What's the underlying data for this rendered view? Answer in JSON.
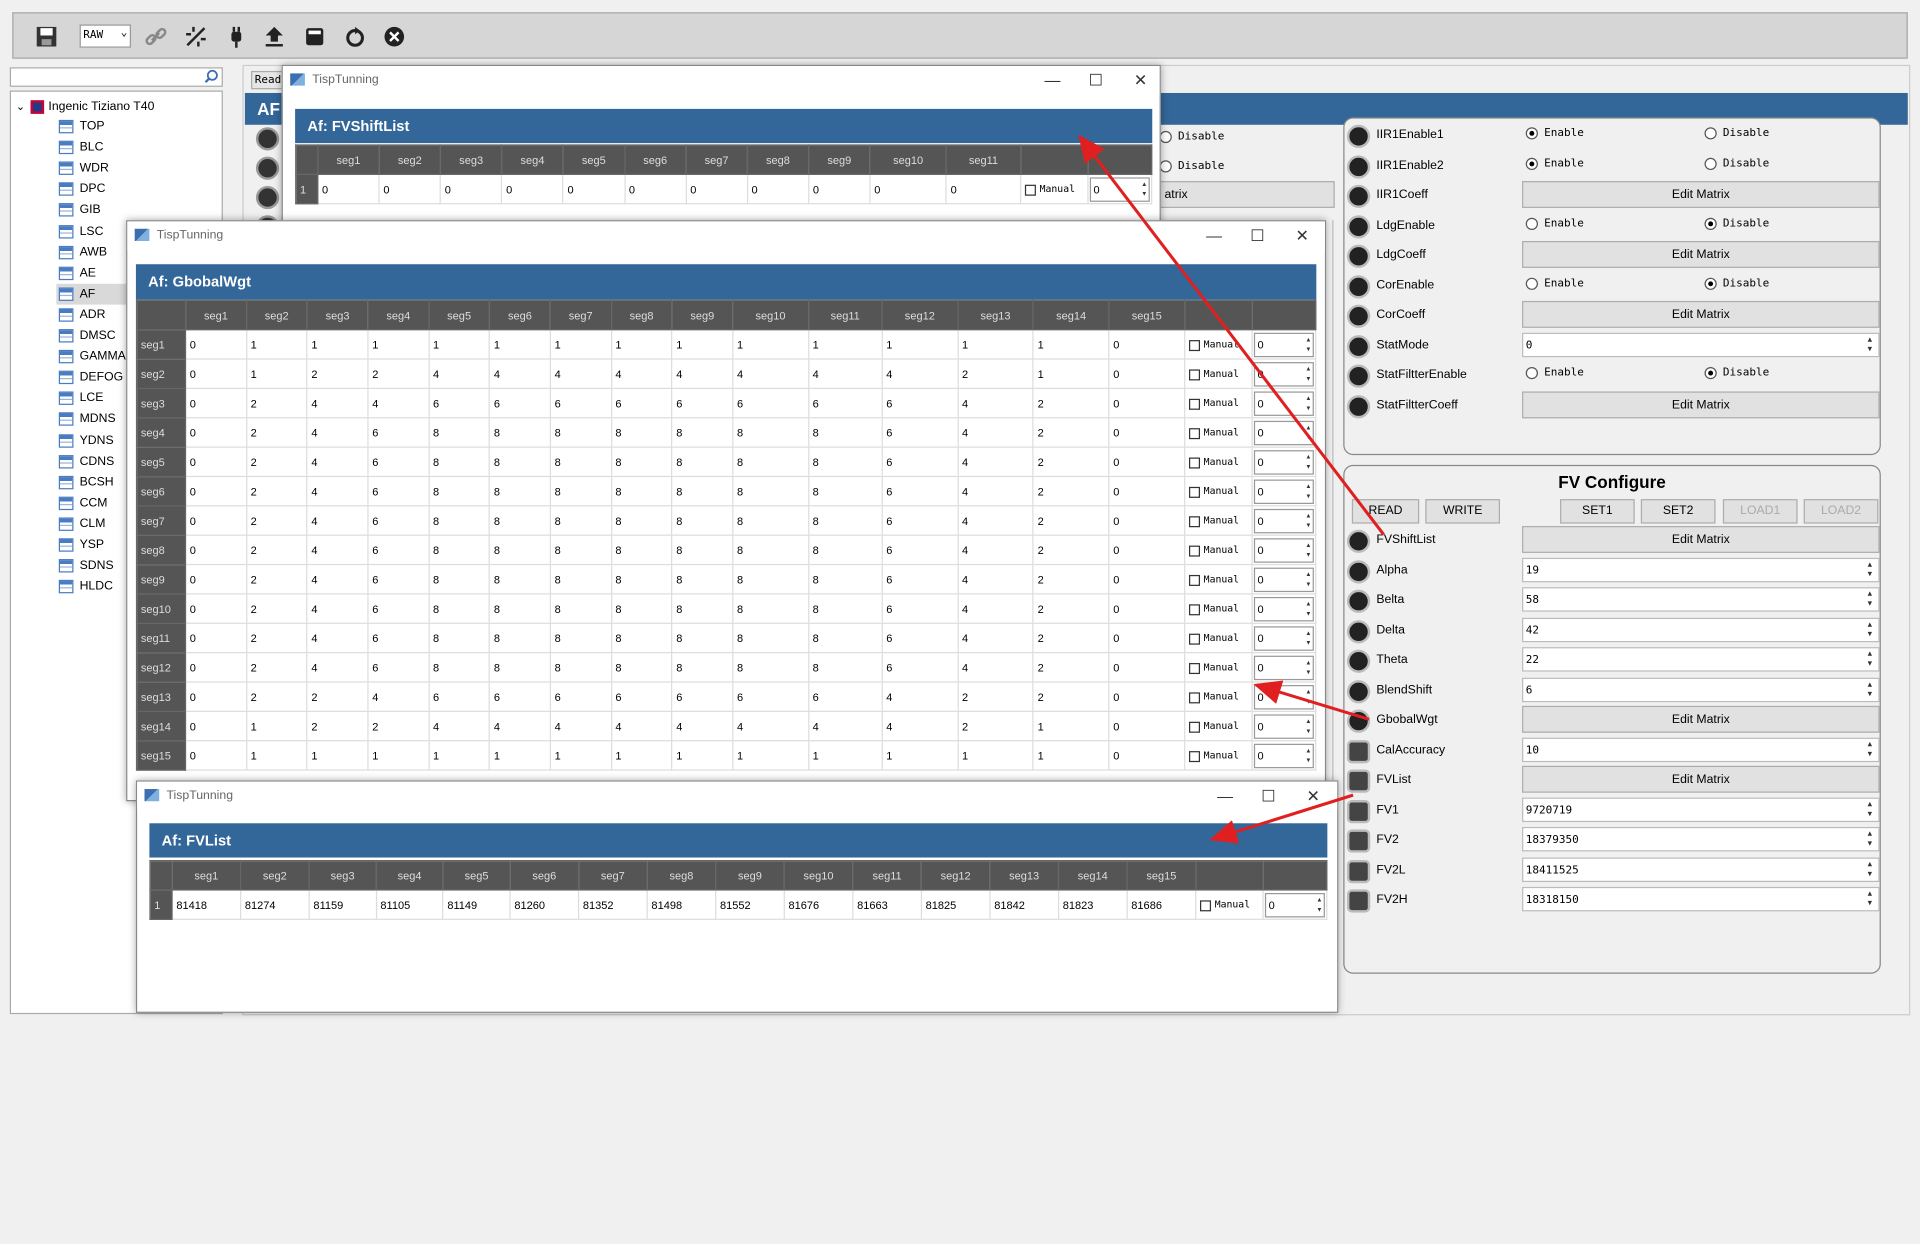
{
  "toolbar": {
    "format_select": "RAW"
  },
  "tree": {
    "root": "Ingenic Tiziano T40",
    "items": [
      "TOP",
      "BLC",
      "WDR",
      "DPC",
      "GIB",
      "LSC",
      "AWB",
      "AE",
      "AF",
      "ADR",
      "DMSC",
      "GAMMA",
      "DEFOG",
      "LCE",
      "MDNS",
      "YDNS",
      "CDNS",
      "BCSH",
      "CCM",
      "CLM",
      "YSP",
      "SDNS",
      "HLDC"
    ],
    "selected": "AF"
  },
  "main": {
    "header": "AF",
    "read_tab": "Read",
    "partial_disable_1": "Disable",
    "partial_disable_2": "Disable",
    "partial_matrix": "atrix"
  },
  "panel_top": {
    "rows": [
      {
        "label": "IIR1Enable1",
        "enable": "Enable",
        "disable": "Disable",
        "state": "enable"
      },
      {
        "label": "IIR1Enable2",
        "enable": "Enable",
        "disable": "Disable",
        "state": "enable"
      },
      {
        "label": "IIR1Coeff",
        "button": "Edit Matrix"
      },
      {
        "label": "LdgEnable",
        "enable": "Enable",
        "disable": "Disable",
        "state": "disable"
      },
      {
        "label": "LdgCoeff",
        "button": "Edit Matrix"
      },
      {
        "label": "CorEnable",
        "enable": "Enable",
        "disable": "Disable",
        "state": "disable"
      },
      {
        "label": "CorCoeff",
        "button": "Edit Matrix"
      },
      {
        "label": "StatMode",
        "value": "0"
      },
      {
        "label": "StatFiltterEnable",
        "enable": "Enable",
        "disable": "Disable",
        "state": "disable"
      },
      {
        "label": "StatFiltterCoeff",
        "button": "Edit Matrix"
      }
    ]
  },
  "fv_configure": {
    "title": "FV Configure",
    "buttons": {
      "read": "READ",
      "write": "WRITE",
      "set1": "SET1",
      "set2": "SET2",
      "load1": "LOAD1",
      "load2": "LOAD2"
    },
    "rows": [
      {
        "label": "FVShiftList",
        "button": "Edit Matrix"
      },
      {
        "label": "Alpha",
        "value": "19"
      },
      {
        "label": "Belta",
        "value": "58"
      },
      {
        "label": "Delta",
        "value": "42"
      },
      {
        "label": "Theta",
        "value": "22"
      },
      {
        "label": "BlendShift",
        "value": "6"
      },
      {
        "label": "GbobalWgt",
        "button": "Edit Matrix"
      },
      {
        "label": "CalAccuracy",
        "value": "10"
      },
      {
        "label": "FVList",
        "button": "Edit Matrix"
      },
      {
        "label": "FV1",
        "value": "9720719"
      },
      {
        "label": "FV2",
        "value": "18379350"
      },
      {
        "label": "FV2L",
        "value": "18411525"
      },
      {
        "label": "FV2H",
        "value": "18318150"
      }
    ]
  },
  "dialogs": {
    "app_title": "TispTunning",
    "manual": "Manual",
    "fvshift": {
      "title": "Af: FVShiftList",
      "cols": [
        "seg1",
        "seg2",
        "seg3",
        "seg4",
        "seg5",
        "seg6",
        "seg7",
        "seg8",
        "seg9",
        "seg10",
        "seg11"
      ],
      "rows": [
        {
          "h": "1",
          "v": [
            "0",
            "0",
            "0",
            "0",
            "0",
            "0",
            "0",
            "0",
            "0",
            "0",
            "0"
          ],
          "spin": "0"
        }
      ]
    },
    "gbobal": {
      "title": "Af: GbobalWgt",
      "cols": [
        "seg1",
        "seg2",
        "seg3",
        "seg4",
        "seg5",
        "seg6",
        "seg7",
        "seg8",
        "seg9",
        "seg10",
        "seg11",
        "seg12",
        "seg13",
        "seg14",
        "seg15"
      ],
      "rows": [
        {
          "h": "seg1",
          "v": [
            "0",
            "1",
            "1",
            "1",
            "1",
            "1",
            "1",
            "1",
            "1",
            "1",
            "1",
            "1",
            "1",
            "1",
            "0"
          ],
          "spin": "0"
        },
        {
          "h": "seg2",
          "v": [
            "0",
            "1",
            "2",
            "2",
            "4",
            "4",
            "4",
            "4",
            "4",
            "4",
            "4",
            "4",
            "2",
            "1",
            "0"
          ],
          "spin": "0"
        },
        {
          "h": "seg3",
          "v": [
            "0",
            "2",
            "4",
            "4",
            "6",
            "6",
            "6",
            "6",
            "6",
            "6",
            "6",
            "6",
            "4",
            "2",
            "0"
          ],
          "spin": "0"
        },
        {
          "h": "seg4",
          "v": [
            "0",
            "2",
            "4",
            "6",
            "8",
            "8",
            "8",
            "8",
            "8",
            "8",
            "8",
            "6",
            "4",
            "2",
            "0"
          ],
          "spin": "0"
        },
        {
          "h": "seg5",
          "v": [
            "0",
            "2",
            "4",
            "6",
            "8",
            "8",
            "8",
            "8",
            "8",
            "8",
            "8",
            "6",
            "4",
            "2",
            "0"
          ],
          "spin": "0"
        },
        {
          "h": "seg6",
          "v": [
            "0",
            "2",
            "4",
            "6",
            "8",
            "8",
            "8",
            "8",
            "8",
            "8",
            "8",
            "6",
            "4",
            "2",
            "0"
          ],
          "spin": "0"
        },
        {
          "h": "seg7",
          "v": [
            "0",
            "2",
            "4",
            "6",
            "8",
            "8",
            "8",
            "8",
            "8",
            "8",
            "8",
            "6",
            "4",
            "2",
            "0"
          ],
          "spin": "0"
        },
        {
          "h": "seg8",
          "v": [
            "0",
            "2",
            "4",
            "6",
            "8",
            "8",
            "8",
            "8",
            "8",
            "8",
            "8",
            "6",
            "4",
            "2",
            "0"
          ],
          "spin": "0"
        },
        {
          "h": "seg9",
          "v": [
            "0",
            "2",
            "4",
            "6",
            "8",
            "8",
            "8",
            "8",
            "8",
            "8",
            "8",
            "6",
            "4",
            "2",
            "0"
          ],
          "spin": "0"
        },
        {
          "h": "seg10",
          "v": [
            "0",
            "2",
            "4",
            "6",
            "8",
            "8",
            "8",
            "8",
            "8",
            "8",
            "8",
            "6",
            "4",
            "2",
            "0"
          ],
          "spin": "0"
        },
        {
          "h": "seg11",
          "v": [
            "0",
            "2",
            "4",
            "6",
            "8",
            "8",
            "8",
            "8",
            "8",
            "8",
            "8",
            "6",
            "4",
            "2",
            "0"
          ],
          "spin": "0"
        },
        {
          "h": "seg12",
          "v": [
            "0",
            "2",
            "4",
            "6",
            "8",
            "8",
            "8",
            "8",
            "8",
            "8",
            "8",
            "6",
            "4",
            "2",
            "0"
          ],
          "spin": "0"
        },
        {
          "h": "seg13",
          "v": [
            "0",
            "2",
            "2",
            "4",
            "6",
            "6",
            "6",
            "6",
            "6",
            "6",
            "6",
            "4",
            "2",
            "2",
            "0"
          ],
          "spin": "0"
        },
        {
          "h": "seg14",
          "v": [
            "0",
            "1",
            "2",
            "2",
            "4",
            "4",
            "4",
            "4",
            "4",
            "4",
            "4",
            "4",
            "2",
            "1",
            "0"
          ],
          "spin": "0"
        },
        {
          "h": "seg15",
          "v": [
            "0",
            "1",
            "1",
            "1",
            "1",
            "1",
            "1",
            "1",
            "1",
            "1",
            "1",
            "1",
            "1",
            "1",
            "0"
          ],
          "spin": "0"
        }
      ]
    },
    "fvlist": {
      "title": "Af: FVList",
      "cols": [
        "seg1",
        "seg2",
        "seg3",
        "seg4",
        "seg5",
        "seg6",
        "seg7",
        "seg8",
        "seg9",
        "seg10",
        "seg11",
        "seg12",
        "seg13",
        "seg14",
        "seg15"
      ],
      "rows": [
        {
          "h": "1",
          "v": [
            "81418",
            "81274",
            "81159",
            "81105",
            "81149",
            "81260",
            "81352",
            "81498",
            "81552",
            "81676",
            "81663",
            "81825",
            "81842",
            "81823",
            "81686"
          ],
          "spin": "0"
        }
      ]
    }
  },
  "colors": {
    "header_blue": "#336699",
    "arrow_red": "#e02020"
  }
}
